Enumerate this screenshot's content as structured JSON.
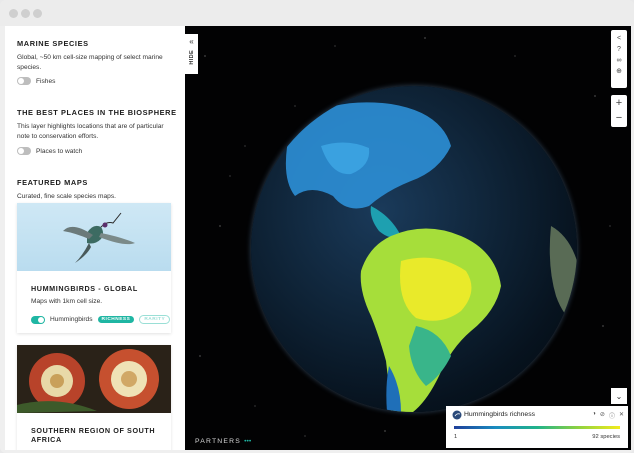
{
  "sidebar": {
    "hide_label": "HIDE",
    "marine": {
      "title": "MARINE SPECIES",
      "description": "Global, ~50 km cell-size mapping of select marine species.",
      "toggle_label": "Fishes"
    },
    "biosphere": {
      "title": "THE BEST PLACES IN THE BIOSPHERE",
      "description": "This layer highlights locations that are of particular note to conservation efforts.",
      "toggle_label": "Places to watch"
    },
    "featured": {
      "title": "FEATURED MAPS",
      "description": "Curated, fine scale species maps.",
      "cards": [
        {
          "title": "HUMMINGBIRDS - GLOBAL",
          "description": "Maps with 1km cell size.",
          "toggle_label": "Hummingbirds",
          "pill_active": "RICHNESS",
          "pill_inactive": "RARITY"
        },
        {
          "title": "SOUTHERN REGION OF SOUTH AFRICA"
        }
      ]
    }
  },
  "footer": {
    "partners_label": "PARTNERS",
    "partners_dots": "•••"
  },
  "legend": {
    "title": "Hummingbirds richness",
    "min": "1",
    "max": "92 species"
  },
  "icons": {
    "share": "share-icon",
    "help": "help-icon",
    "binoculars": "binoculars-icon",
    "location": "location-icon",
    "zoom_in": "zoom-in-icon",
    "zoom_out": "zoom-out-icon",
    "collapse_legend": "chevron-double-down-icon"
  },
  "colors": {
    "accent": "#1fb6a3"
  }
}
